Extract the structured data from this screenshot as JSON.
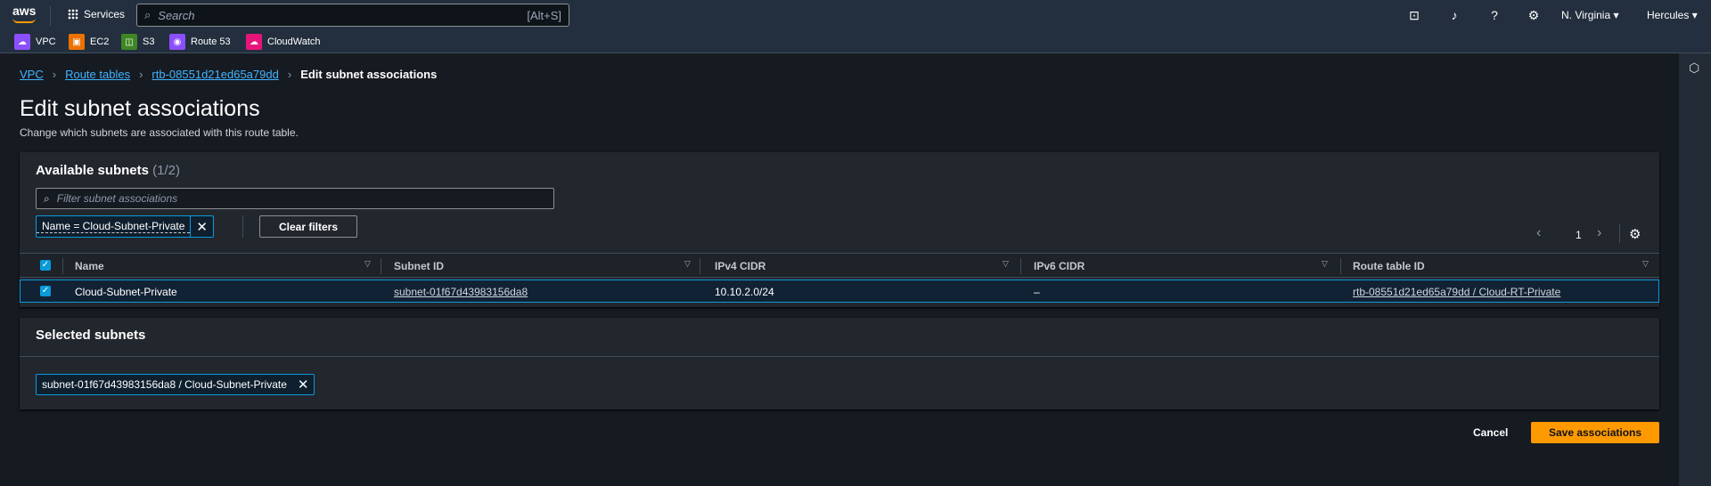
{
  "nav": {
    "logo": "aws",
    "services": "Services",
    "search_placeholder": "Search",
    "search_shortcut": "[Alt+S]",
    "region": "N. Virginia",
    "user": "Hercules"
  },
  "favorites": [
    {
      "label": "VPC",
      "color": "#8c4fff"
    },
    {
      "label": "EC2",
      "color": "#ed7100"
    },
    {
      "label": "S3",
      "color": "#3f8624"
    },
    {
      "label": "Route 53",
      "color": "#8c4fff"
    },
    {
      "label": "CloudWatch",
      "color": "#e7157b"
    }
  ],
  "breadcrumb": [
    "VPC",
    "Route tables",
    "rtb-08551d21ed65a79dd",
    "Edit subnet associations"
  ],
  "page": {
    "title": "Edit subnet associations",
    "description": "Change which subnets are associated with this route table."
  },
  "available": {
    "title": "Available subnets",
    "count": "(1/2)",
    "filter_placeholder": "Filter subnet associations",
    "filter_token": "Name = Cloud-Subnet-Private",
    "clear_filters": "Clear filters",
    "page": "1",
    "columns": [
      "Name",
      "Subnet ID",
      "IPv4 CIDR",
      "IPv6 CIDR",
      "Route table ID"
    ],
    "rows": [
      {
        "name": "Cloud-Subnet-Private",
        "subnet_id": "subnet-01f67d43983156da8",
        "ipv4": "10.10.2.0/24",
        "ipv6": "–",
        "route_table": "rtb-08551d21ed65a79dd / Cloud-RT-Private",
        "selected": true
      }
    ]
  },
  "selected": {
    "title": "Selected subnets",
    "token": "subnet-01f67d43983156da8 / Cloud-Subnet-Private"
  },
  "actions": {
    "cancel": "Cancel",
    "save": "Save associations"
  }
}
